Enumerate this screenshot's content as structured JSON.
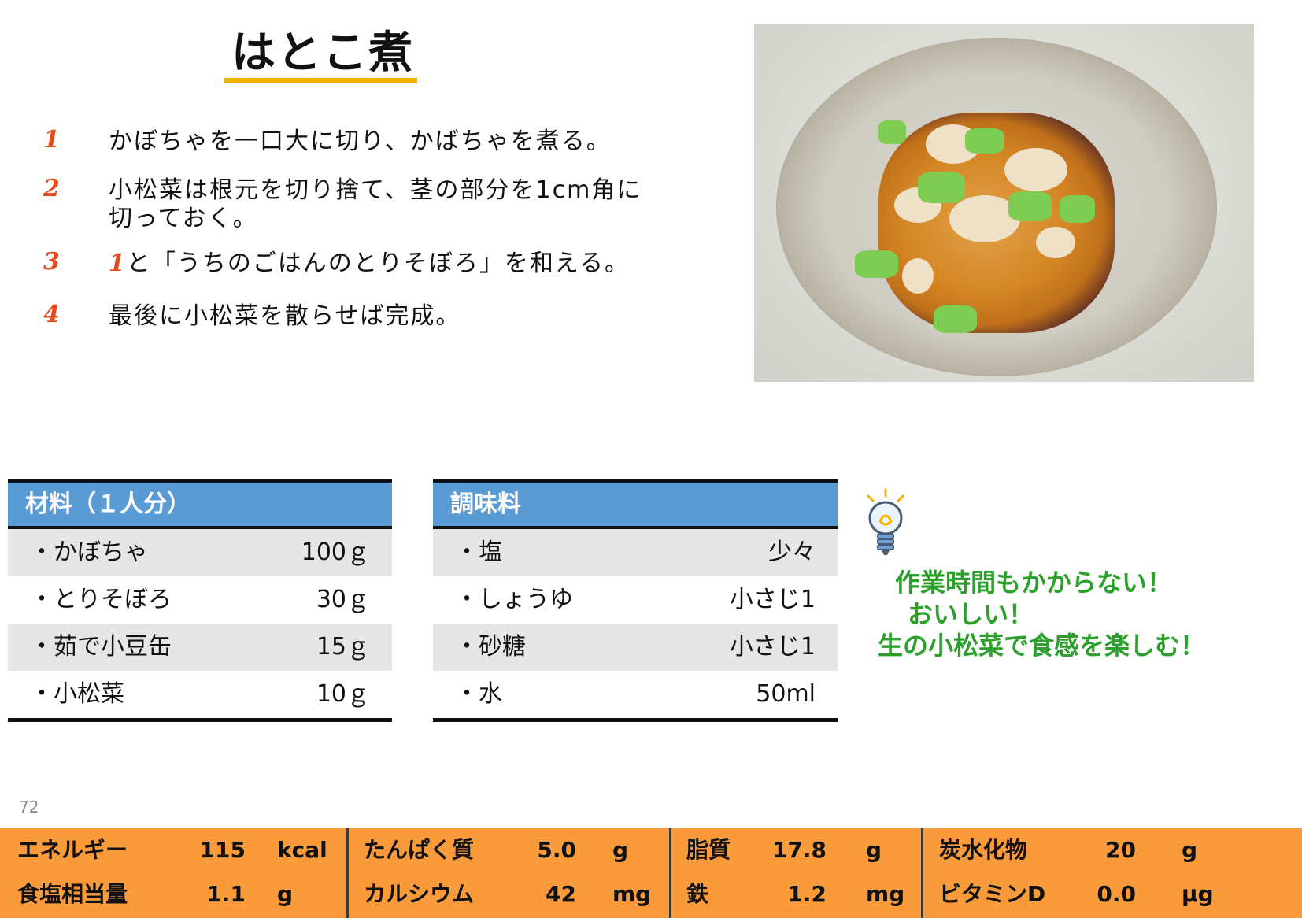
{
  "title": "はとこ煮",
  "steps": [
    {
      "num": "1",
      "lines": [
        "かぼちゃを一口大に切り、かばちゃを煮る。"
      ]
    },
    {
      "num": "2",
      "lines": [
        "小松菜は根元を切り捨て、茎の部分を1cm角に",
        "切っておく。"
      ]
    },
    {
      "num": "3",
      "prefix": "1",
      "lines": [
        "と「うちのごはんのとりそぼろ」を和える。"
      ]
    },
    {
      "num": "4",
      "lines": [
        "最後に小松菜を散らせば完成。"
      ]
    }
  ],
  "ingredients": {
    "header": "材料（１人分）",
    "rows": [
      {
        "name": "・かぼちゃ",
        "qty": "100ｇ"
      },
      {
        "name": "・とりそぼろ",
        "qty": "30ｇ"
      },
      {
        "name": "・茹で小豆缶",
        "qty": "15ｇ"
      },
      {
        "name": "・小松菜",
        "qty": "10ｇ"
      }
    ]
  },
  "seasonings": {
    "header": "調味料",
    "rows": [
      {
        "name": "・塩",
        "qty": "少々"
      },
      {
        "name": "・しょうゆ",
        "qty": "小さじ1"
      },
      {
        "name": "・砂糖",
        "qty": "小さじ1"
      },
      {
        "name": "・水",
        "qty": "50ml"
      }
    ]
  },
  "tip": {
    "lines": [
      "作業時間もかからない！",
      "おいしい！",
      "生の小松菜で食感を楽しむ！"
    ],
    "icon": "lightbulb-icon"
  },
  "page_number": "72",
  "nutrition": [
    {
      "label": "エネルギー",
      "value": "115",
      "unit": "kcal"
    },
    {
      "label": "たんぱく質",
      "value": "5.0",
      "unit": "g"
    },
    {
      "label": "脂質",
      "value": "17.8",
      "unit": "g"
    },
    {
      "label": "炭水化物",
      "value": "20",
      "unit": "g"
    },
    {
      "label": "食塩相当量",
      "value": "1.1",
      "unit": "g"
    },
    {
      "label": "カルシウム",
      "value": "42",
      "unit": "mg"
    },
    {
      "label": "鉄",
      "value": "1.2",
      "unit": "mg"
    },
    {
      "label": "ビタミンD",
      "value": "0.0",
      "unit": "μg"
    }
  ],
  "colors": {
    "title_underline": "#f2b300",
    "step_number": "#e8471a",
    "table_header": "#5b9bd5",
    "tip_text": "#2ba02b",
    "nutrition_bar": "#f99a3b"
  }
}
